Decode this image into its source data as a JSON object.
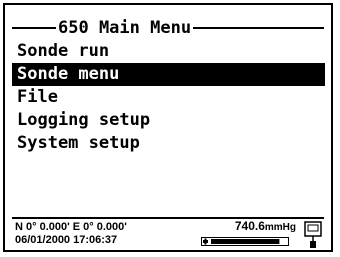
{
  "screen": {
    "title": "650 Main Menu",
    "menu_items": [
      {
        "label": "Sonde run",
        "selected": false
      },
      {
        "label": "Sonde menu",
        "selected": true
      },
      {
        "label": "File",
        "selected": false
      },
      {
        "label": "Logging setup",
        "selected": false
      },
      {
        "label": "System setup",
        "selected": false
      }
    ]
  },
  "status_bar": {
    "gps": "N 0° 0.000' E 0° 0.000'",
    "datetime": "06/01/2000 17:06:37",
    "pressure_value": "740.6",
    "pressure_unit": "mmHg",
    "battery_level": 0.9,
    "icons": [
      "battery-icon",
      "sonde-icon"
    ]
  }
}
